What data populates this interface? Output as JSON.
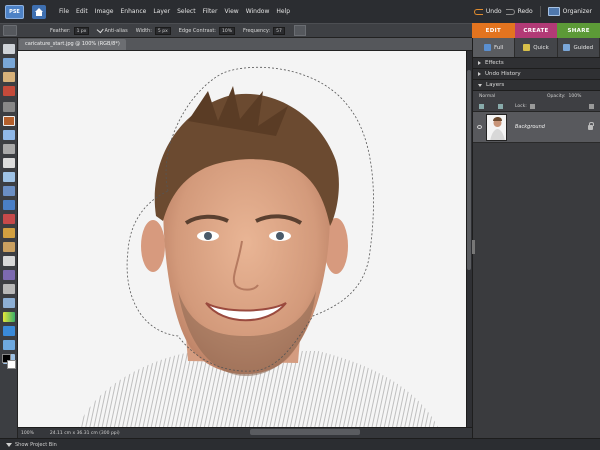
{
  "app": {
    "logo_text": "PSE"
  },
  "menu": [
    "File",
    "Edit",
    "Image",
    "Enhance",
    "Layer",
    "Select",
    "Filter",
    "View",
    "Window",
    "Help"
  ],
  "toprright": {
    "undo": "Undo",
    "redo": "Redo",
    "organizer": "Organizer"
  },
  "options": {
    "feather_label": "Feather:",
    "feather_value": "1 px",
    "antialias_label": "Anti-alias",
    "width_label": "Width:",
    "width_value": "5 px",
    "edge_contrast_label": "Edge Contrast:",
    "edge_contrast_value": "10%",
    "frequency_label": "Frequency:",
    "frequency_value": "57"
  },
  "modes": {
    "edit": "EDIT",
    "create": "CREATE",
    "share": "SHARE"
  },
  "view_tabs": {
    "full": "Full",
    "quick": "Quick",
    "guided": "Guided"
  },
  "document": {
    "tab_title": "caricature_start.jpg @ 100% (RGB/8*)",
    "zoom": "100%",
    "doc_info": "24.11 cm x 36.31 cm (300 ppi)"
  },
  "panels": {
    "effects": "Effects",
    "undo_history": "Undo History",
    "layers": "Layers",
    "blend_mode": "Normal",
    "opacity_label": "Opacity:",
    "opacity_value": "100%",
    "lock_label": "Lock:",
    "layer_name": "Background"
  },
  "bin": {
    "label": "Show Project Bin"
  },
  "colors": {
    "edit": "#e3741f",
    "create": "#b23a76",
    "share": "#5c9a37",
    "ui_dark": "#2b2d31"
  }
}
